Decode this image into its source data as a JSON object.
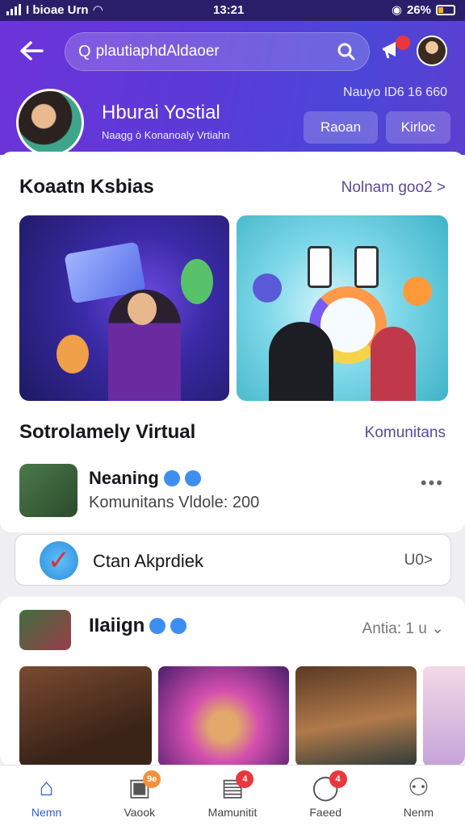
{
  "status_bar": {
    "carrier": "I bioae Urn",
    "time": "13:21",
    "battery": "26%"
  },
  "header": {
    "search_text": "plautiaphdAldaoer",
    "profile_name": "Hburai Yostial",
    "profile_sub": "Naagg ò Konanoaly Vrtiahn",
    "stats": "Nauyo   ID6 16 660",
    "btn_1": "Raoan",
    "btn_2": "Kirloc"
  },
  "section1": {
    "title": "Koaatn Ksbias",
    "link": "Nolnam goo2 >"
  },
  "section2": {
    "title": "Sotrolamely Virtual",
    "link": "Komunitans"
  },
  "row": {
    "title": "Neaning",
    "subtitle": "Komunitans Vldole: 200"
  },
  "action": {
    "label": "Ctan Akprdiek",
    "value": "U0>"
  },
  "card2": {
    "title": "IIaiign",
    "meta": "Antia: 1 u"
  },
  "nav": {
    "items": [
      {
        "label": "Nemn",
        "icon": "home-icon",
        "active": true
      },
      {
        "label": "Vaook",
        "icon": "video-icon",
        "badge": "9e"
      },
      {
        "label": "Mamunitit",
        "icon": "document-icon",
        "badge": "4"
      },
      {
        "label": "Faeed",
        "icon": "chat-icon",
        "badge": "4"
      },
      {
        "label": "Nenm",
        "icon": "profile-icon"
      }
    ]
  },
  "colors": {
    "header_start": "#6d33d8",
    "header_end": "#4b46d8",
    "accent": "#2d5bd8",
    "link": "#5a4a9a",
    "badge_red": "#e8383d",
    "badge_orange": "#f2913a"
  }
}
